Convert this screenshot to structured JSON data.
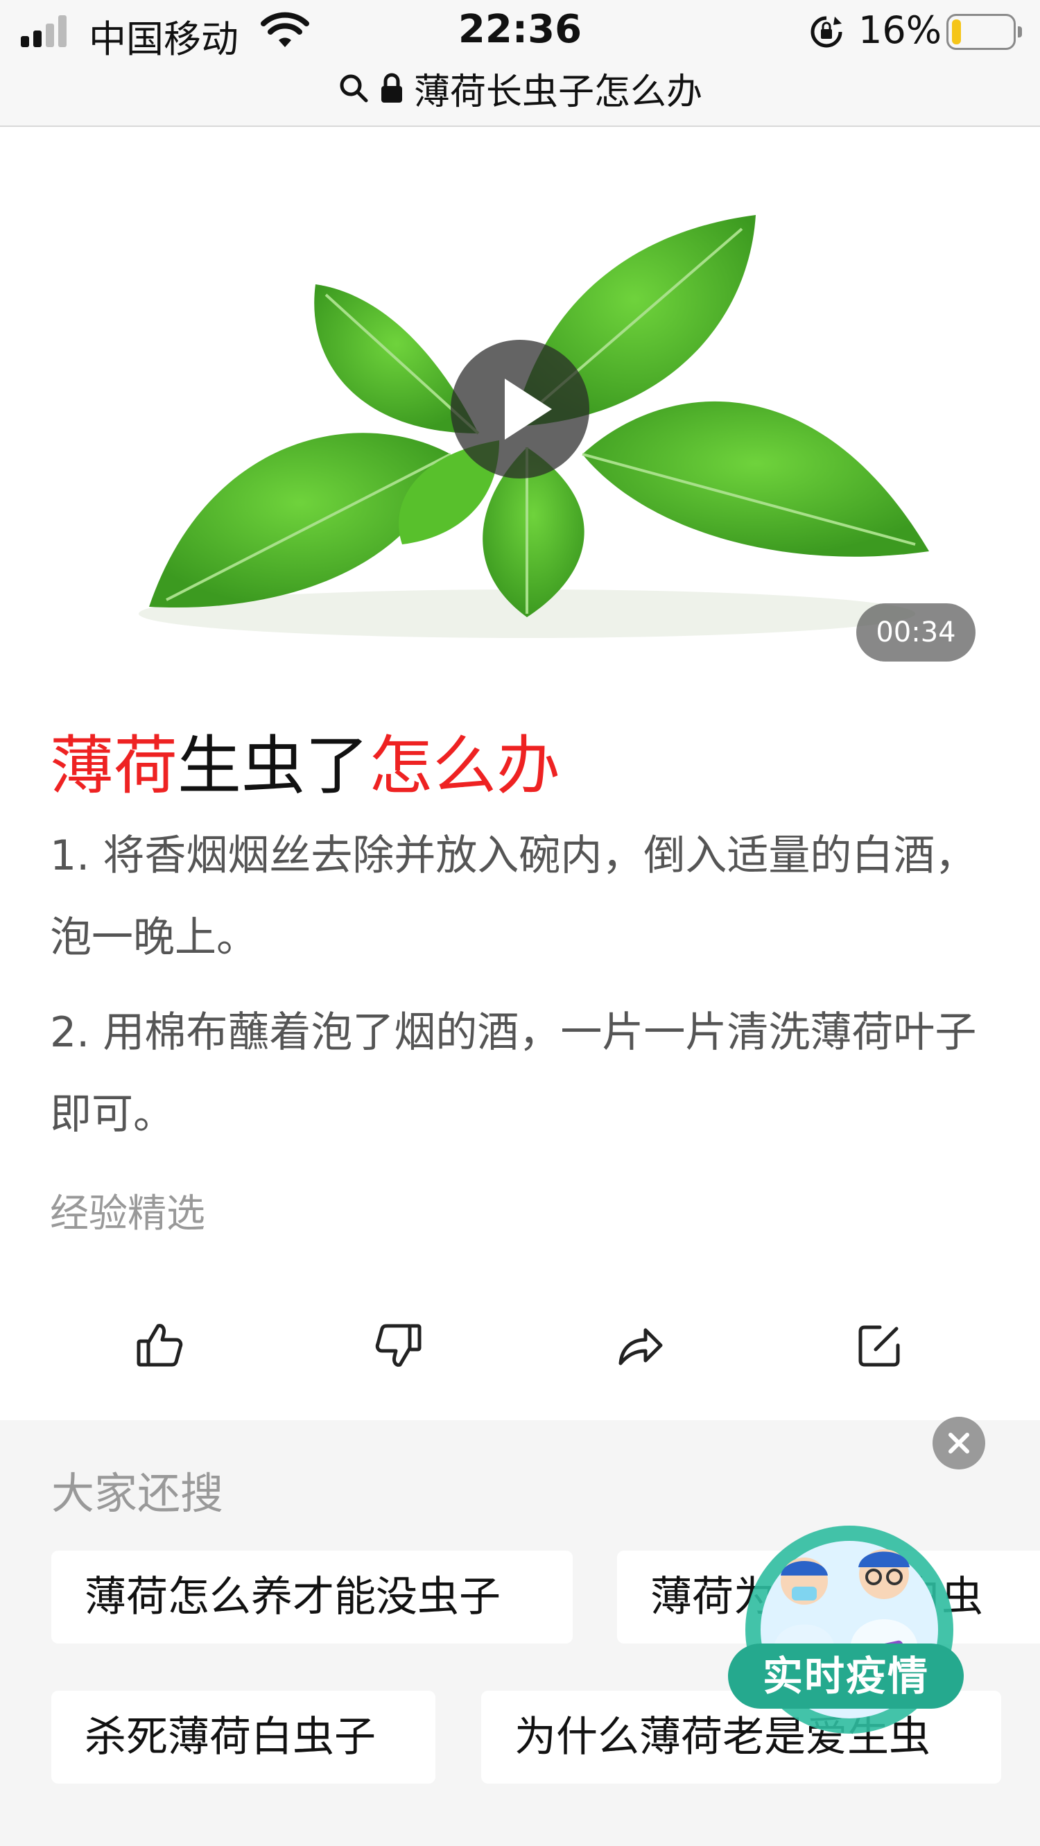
{
  "status_bar": {
    "carrier": "中国移动",
    "time": "22:36",
    "battery_percent": "16%",
    "battery_level": 0.16
  },
  "url_bar": {
    "query": "薄荷长虫子怎么办"
  },
  "video": {
    "duration": "00:34"
  },
  "article": {
    "title_part1": "薄荷",
    "title_part2": "生虫了",
    "title_part3": "怎么办",
    "steps": [
      "1. 将香烟烟丝去除并放入碗内，倒入适量的白酒，泡一晚上。",
      "2. 用棉布蘸着泡了烟的酒，一片一片清洗薄荷叶子即可。"
    ],
    "source": "经验精选"
  },
  "actions": [
    {
      "icon": "thumbs-up-icon"
    },
    {
      "icon": "thumbs-down-icon"
    },
    {
      "icon": "share-icon"
    },
    {
      "icon": "edit-icon"
    }
  ],
  "related_searches": {
    "title": "大家还搜",
    "chips": [
      "薄荷怎么养才能没虫子",
      "薄荷为什么长白虫",
      "杀死薄荷白虫子",
      "为什么薄荷老是爱生虫"
    ]
  },
  "floating_badge": {
    "label": "实时疫情"
  },
  "colors": {
    "highlight": "#ee2222",
    "badge": "#25a98e",
    "leaf": "#4caf2a"
  }
}
